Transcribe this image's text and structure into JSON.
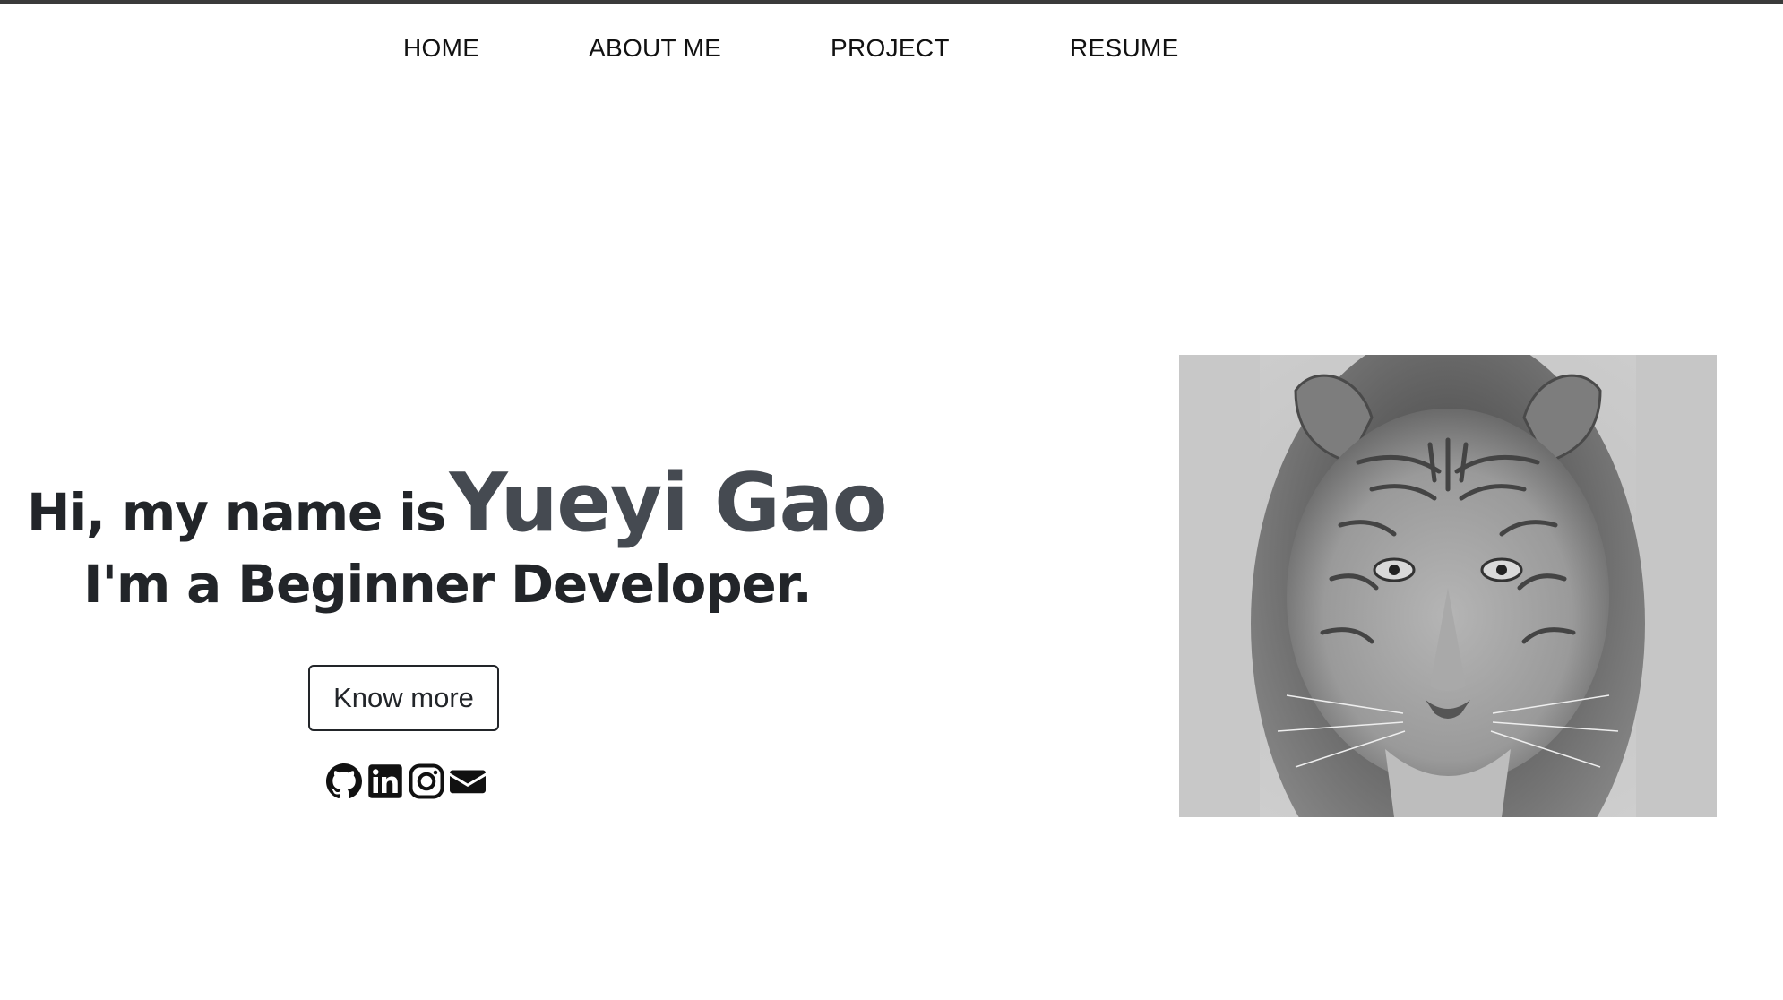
{
  "nav": {
    "items": [
      {
        "label": "HOME"
      },
      {
        "label": "ABOUT ME"
      },
      {
        "label": "PROJECT"
      },
      {
        "label": "RESUME"
      }
    ]
  },
  "hero": {
    "intro": "Hi, my name is",
    "name": "Yueyi Gao",
    "tagline": "I'm a Beginner Developer.",
    "button_label": "Know more"
  },
  "social": {
    "icons": [
      "github-icon",
      "linkedin-icon",
      "instagram-icon",
      "email-icon"
    ]
  },
  "photo": {
    "subject": "tiger-face"
  }
}
